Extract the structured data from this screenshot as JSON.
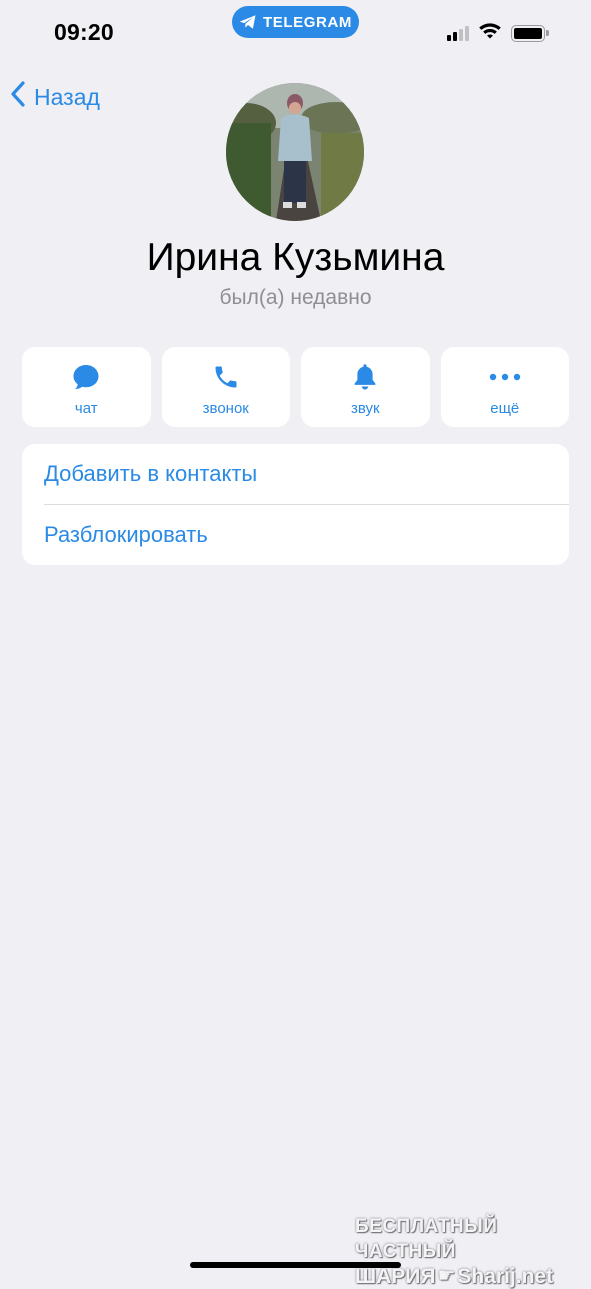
{
  "status_bar": {
    "time": "09:20",
    "app_pill": "TELEGRAM",
    "signal_bars_active": 2,
    "signal_bars_total": 4,
    "battery_level": 1.0
  },
  "nav": {
    "back_label": "Назад"
  },
  "profile": {
    "name": "Ирина Кузьмина",
    "last_seen": "был(а) недавно"
  },
  "actions": [
    {
      "label": "чат",
      "icon": "chat-bubble-icon"
    },
    {
      "label": "звонок",
      "icon": "phone-icon"
    },
    {
      "label": "звук",
      "icon": "bell-icon"
    },
    {
      "label": "ещё",
      "icon": "more-icon"
    }
  ],
  "menu": {
    "add_contact": "Добавить в контакты",
    "unblock": "Разблокировать"
  },
  "watermark": {
    "line1": "БЕСПЛАТНЫЙ ЧАСТНЫЙ",
    "line2_left": "ШАРИЯ",
    "line2_right": "Sharij.net"
  },
  "colors": {
    "accent": "#2a8ae5",
    "background": "#efeff4",
    "card": "#ffffff",
    "secondary_text": "#8e8e93"
  }
}
